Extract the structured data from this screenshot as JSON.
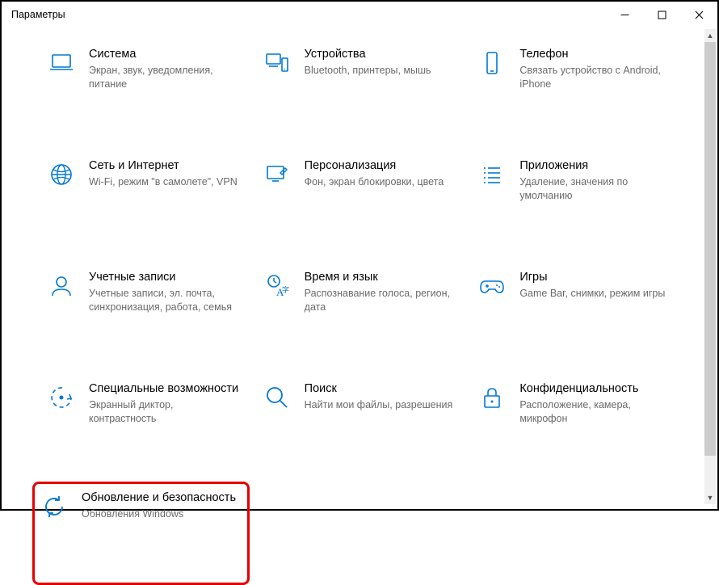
{
  "window": {
    "title": "Параметры"
  },
  "tiles": [
    {
      "title": "Система",
      "desc": "Экран, звук, уведомления, питание"
    },
    {
      "title": "Устройства",
      "desc": "Bluetooth, принтеры, мышь"
    },
    {
      "title": "Телефон",
      "desc": "Связать устройство с Android, iPhone"
    },
    {
      "title": "Сеть и Интернет",
      "desc": "Wi-Fi, режим \"в самолете\", VPN"
    },
    {
      "title": "Персонализация",
      "desc": "Фон, экран блокировки, цвета"
    },
    {
      "title": "Приложения",
      "desc": "Удаление, значения по умолчанию"
    },
    {
      "title": "Учетные записи",
      "desc": "Учетные записи, эл. почта, синхронизация, работа, семья"
    },
    {
      "title": "Время и язык",
      "desc": "Распознавание голоса, регион, дата"
    },
    {
      "title": "Игры",
      "desc": "Game Bar, снимки, режим игры"
    },
    {
      "title": "Специальные возможности",
      "desc": "Экранный диктор, контрастность"
    },
    {
      "title": "Поиск",
      "desc": "Найти мои файлы, разрешения"
    },
    {
      "title": "Конфиденциальность",
      "desc": "Расположение, камера, микрофон"
    },
    {
      "title": "Обновление и безопасность",
      "desc": "Обновления Windows"
    }
  ]
}
